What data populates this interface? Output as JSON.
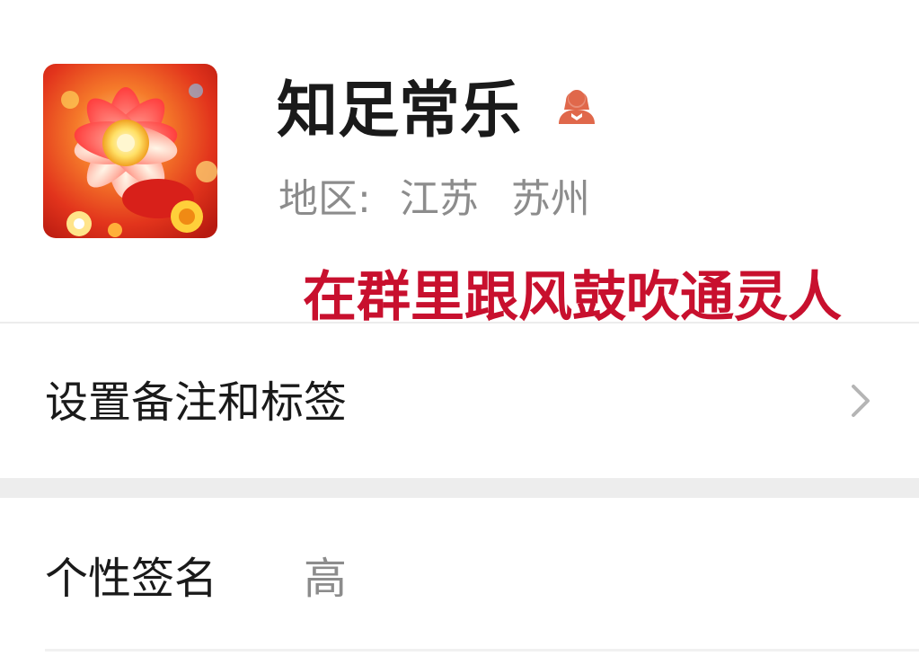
{
  "profile": {
    "name": "知足常乐",
    "region_label": "地区:",
    "region_province": "江苏",
    "region_city": "苏州",
    "gender_icon": "female-user-icon",
    "gender_icon_color": "#e0684b"
  },
  "annotation": {
    "text": "在群里跟风鼓吹通灵人",
    "color": "#c8102e"
  },
  "rows": {
    "remark_label": "设置备注和标签",
    "signature_label": "个性签名",
    "signature_value": "高"
  },
  "icons": {
    "chevron": "chevron-right-icon",
    "avatar": "flower-avatar-image"
  }
}
